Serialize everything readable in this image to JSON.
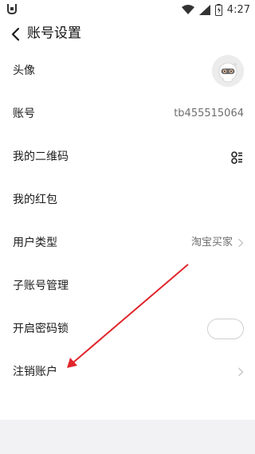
{
  "status_bar": {
    "time": "4:27",
    "icons": [
      "app-shield-icon",
      "wifi-icon",
      "signal-icon",
      "battery-icon"
    ]
  },
  "header": {
    "title": "账号设置",
    "back_icon": "chevron-left-icon"
  },
  "settings": {
    "avatar": {
      "label": "头像",
      "icon": "avatar-icon"
    },
    "account": {
      "label": "账号",
      "value": "tb455515064"
    },
    "qrcode": {
      "label": "我的二维码",
      "icon": "qr-code-icon"
    },
    "red_packet": {
      "label": "我的红包"
    },
    "user_type": {
      "label": "用户类型",
      "value": "淘宝买家"
    },
    "sub_account": {
      "label": "子账号管理"
    },
    "password_lock": {
      "label": "开启密码锁",
      "toggle_on": false
    },
    "cancel_account": {
      "label": "注销账户"
    }
  },
  "annotation": {
    "color": "#e0262b",
    "points_to": "cancel_account"
  },
  "colors": {
    "background": "#f2f2f4",
    "list_background": "#ffffff",
    "secondary_text": "#6e6e6e",
    "chevron": "#c8c8c8"
  }
}
